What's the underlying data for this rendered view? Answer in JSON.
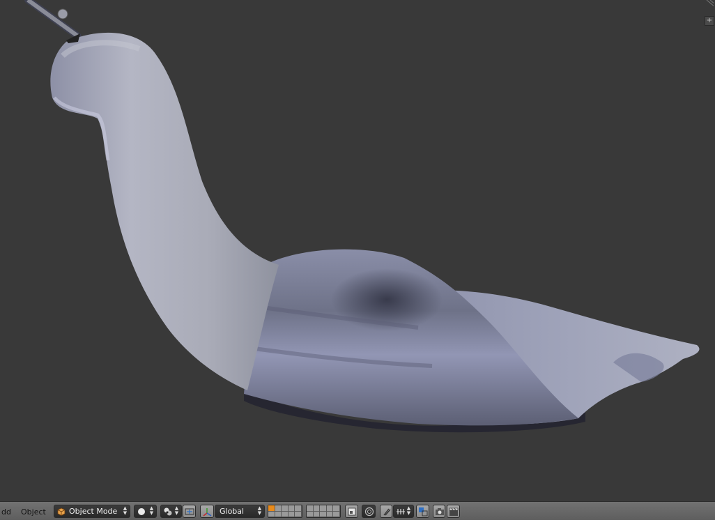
{
  "header": {
    "menu_add_partial": "dd",
    "menu_object": "Object",
    "mode_label": "Object Mode",
    "orientation_label": "Global"
  },
  "icons": {
    "mode": "object-cube-icon",
    "shading": "solid-sphere-icon",
    "pivot": "pivot-point-icon",
    "manipulator": "manipulator-axes-icon",
    "layers": "layer-grid-icon",
    "lock": "lock-camera-icon",
    "proportional": "proportional-edit-icon",
    "snap": "snap-magnet-icon",
    "render": "render-camera-icon",
    "animation": "clapboard-icon"
  },
  "colors": {
    "viewport_bg": "#393939",
    "header_bg": "#6b6b6b",
    "mesh": "#a3a8c4",
    "active_layer": "#e88a1a"
  }
}
